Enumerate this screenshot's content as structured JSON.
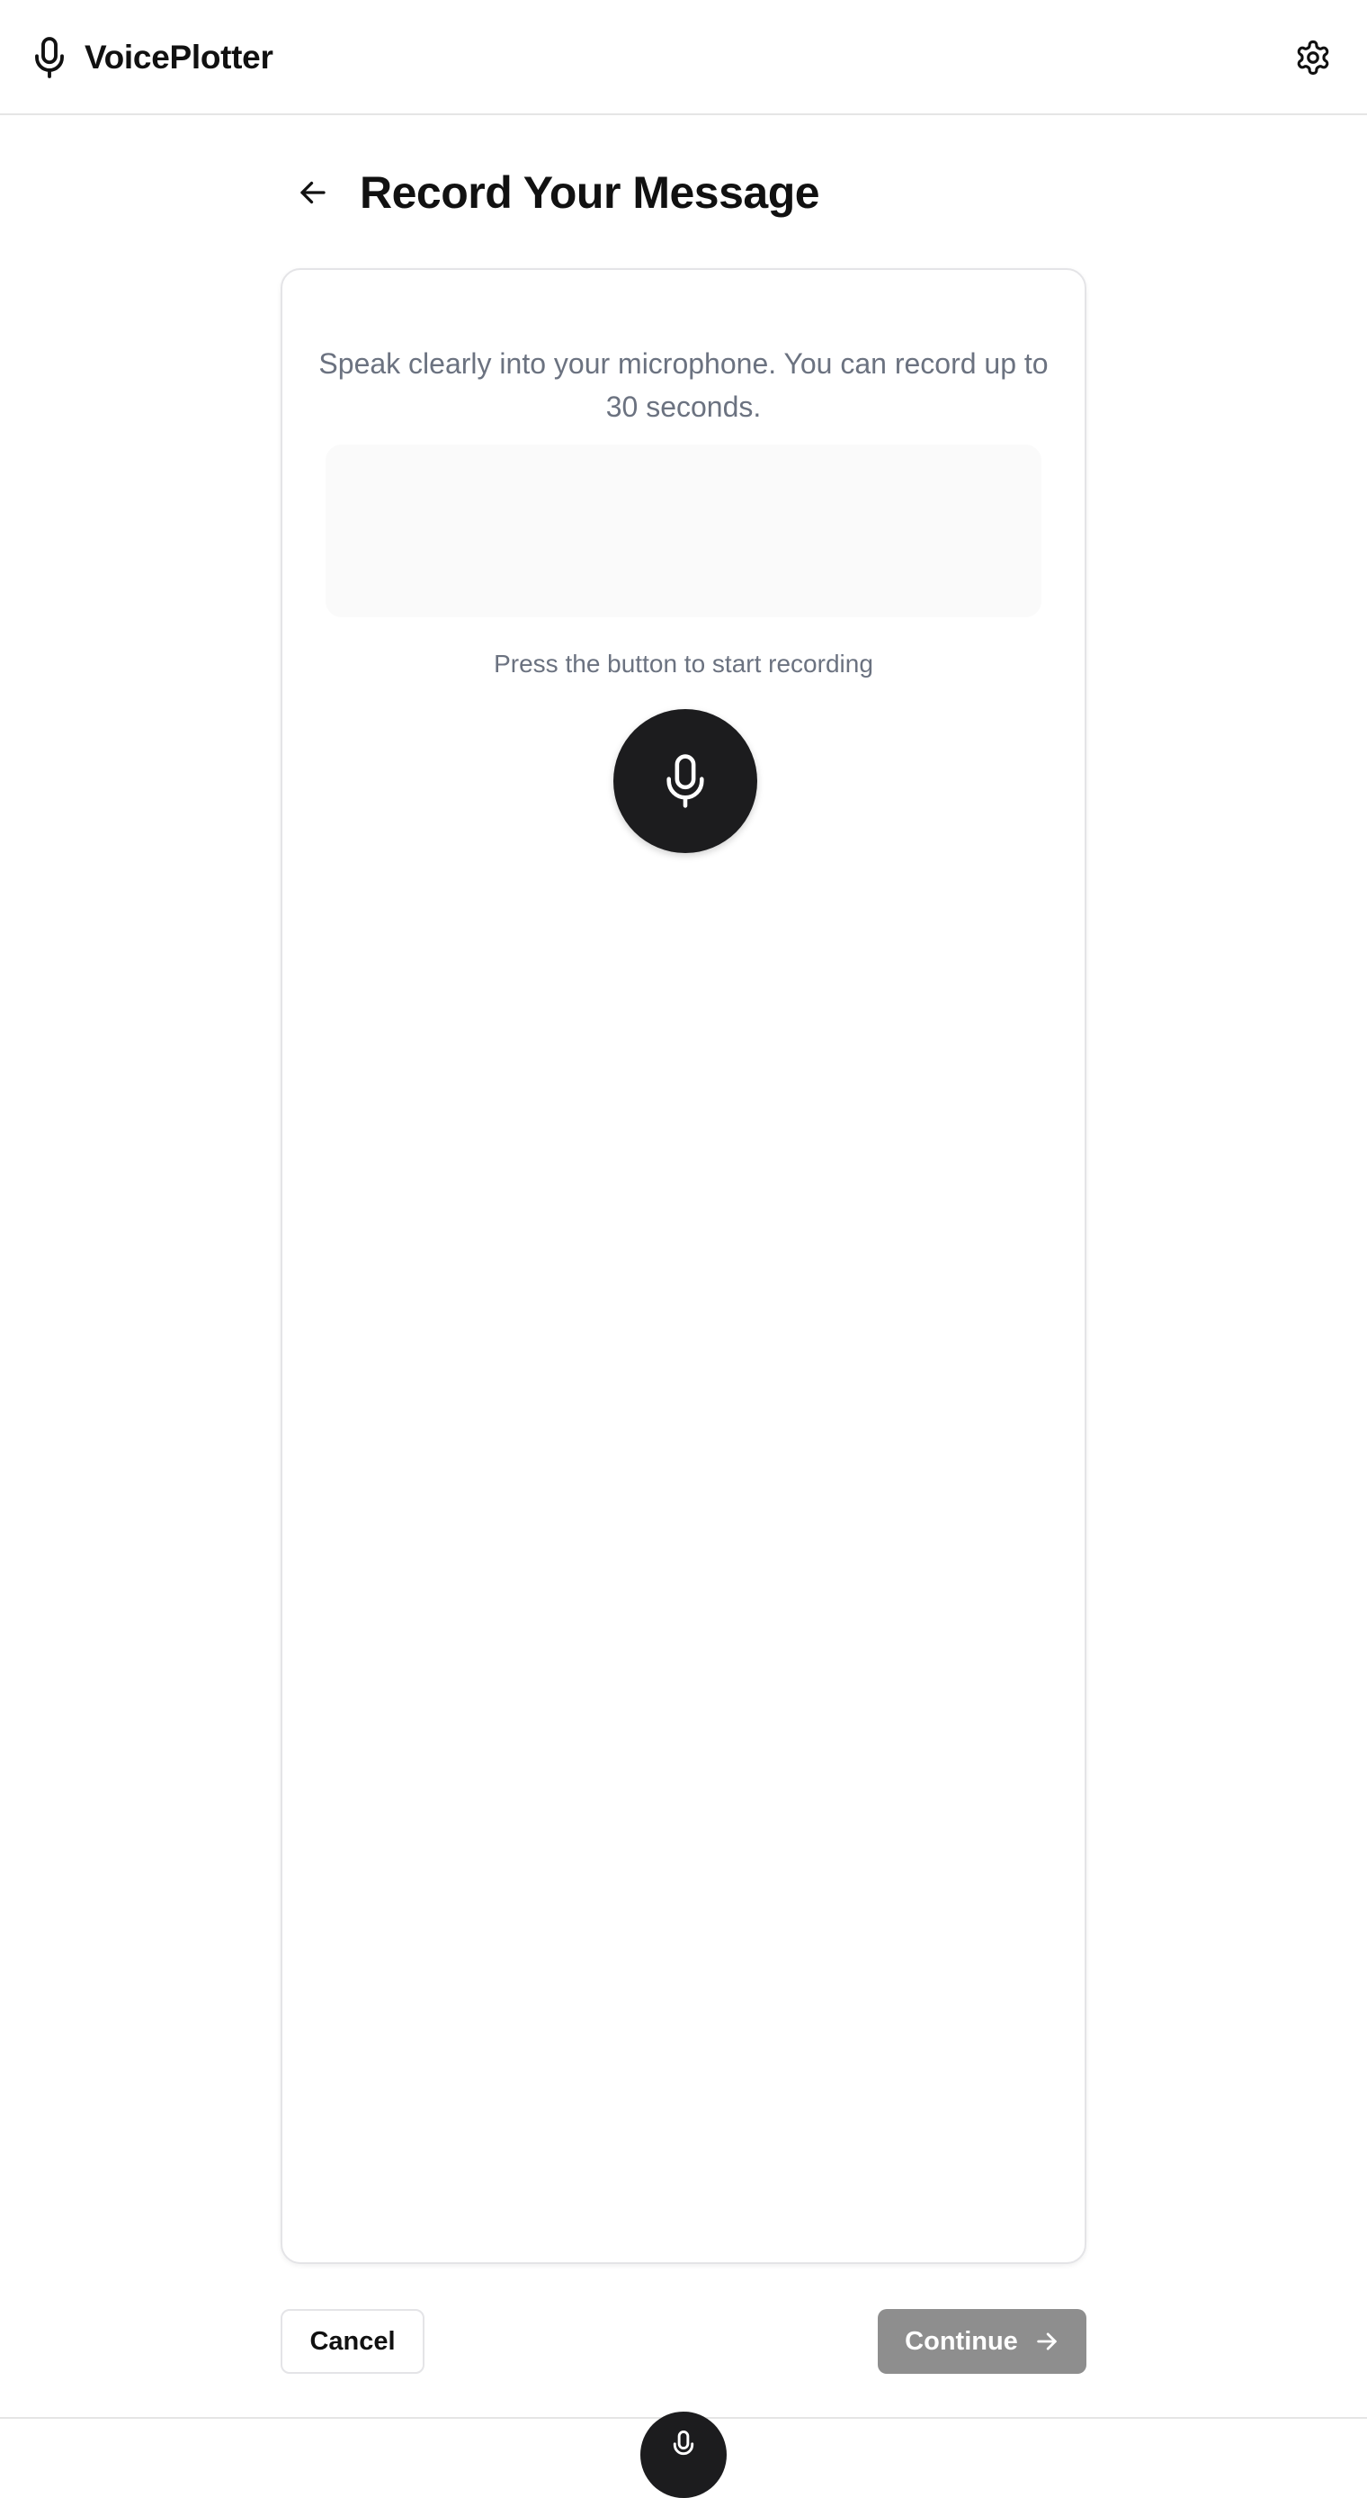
{
  "header": {
    "app_name": "VoicePlotter",
    "brand_icon": "microphone-icon",
    "settings_icon": "gear-icon"
  },
  "page": {
    "title": "Record Your Message",
    "back_icon": "arrow-left-icon"
  },
  "recorder": {
    "instructions": "Speak clearly into your microphone. You can record up to 30 seconds.",
    "hint": "Press the button to start recording",
    "record_icon": "microphone-icon"
  },
  "footer": {
    "cancel_label": "Cancel",
    "continue_label": "Continue",
    "continue_icon": "arrow-right-icon"
  },
  "colors": {
    "primary": "#1c1c1e",
    "disabled_button": "#8e8e8e",
    "muted_text": "#6b7280",
    "border": "#e4e4e7"
  }
}
